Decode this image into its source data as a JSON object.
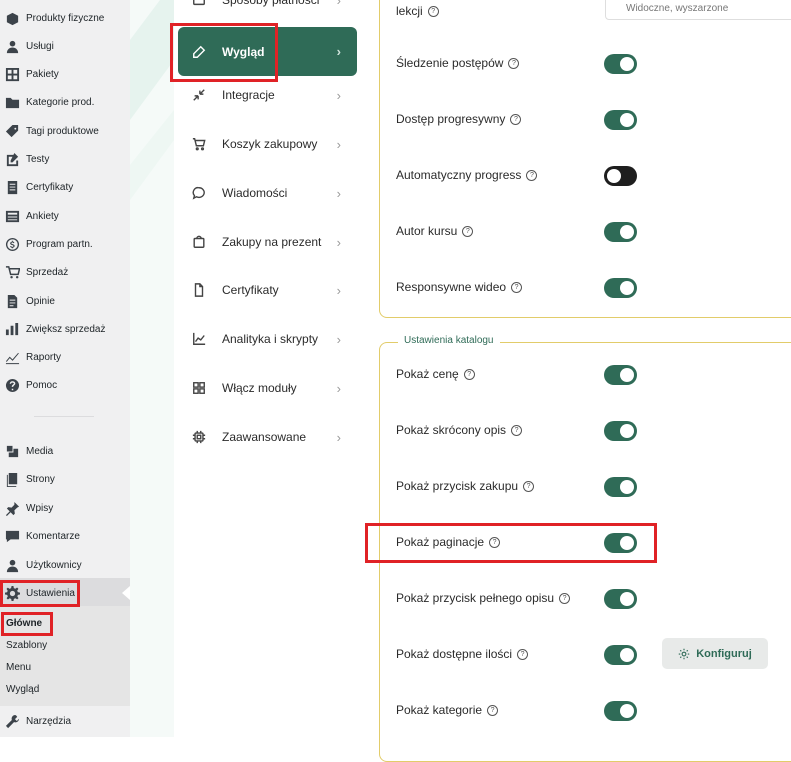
{
  "sidebar": {
    "items": [
      {
        "label": "Produkty fizyczne",
        "icon": "box-icon"
      },
      {
        "label": "Usługi",
        "icon": "user-icon"
      },
      {
        "label": "Pakiety",
        "icon": "grid-icon"
      },
      {
        "label": "Kategorie prod.",
        "icon": "folder-icon"
      },
      {
        "label": "Tagi produktowe",
        "icon": "tag-icon"
      },
      {
        "label": "Testy",
        "icon": "edit-icon"
      },
      {
        "label": "Certyfikaty",
        "icon": "document-icon"
      },
      {
        "label": "Ankiety",
        "icon": "form-icon"
      },
      {
        "label": "Program partn.",
        "icon": "dollar-icon"
      },
      {
        "label": "Sprzedaż",
        "icon": "cart-icon"
      },
      {
        "label": "Opinie",
        "icon": "page-icon"
      },
      {
        "label": "Zwiększ sprzedaż",
        "icon": "bar-chart-icon"
      },
      {
        "label": "Raporty",
        "icon": "line-chart-icon"
      },
      {
        "label": "Pomoc",
        "icon": "help-icon"
      },
      {
        "label": "Media",
        "icon": "media-icon"
      },
      {
        "label": "Strony",
        "icon": "pages-icon"
      },
      {
        "label": "Wpisy",
        "icon": "pin-icon"
      },
      {
        "label": "Komentarze",
        "icon": "comment-icon"
      },
      {
        "label": "Użytkownicy",
        "icon": "users-icon"
      },
      {
        "label": "Ustawienia",
        "icon": "gear-icon"
      },
      {
        "label": "Narzędzia",
        "icon": "wrench-icon"
      }
    ],
    "submenu": [
      "Główne",
      "Szablony",
      "Menu",
      "Wygląd"
    ]
  },
  "plugin_nav": {
    "items": [
      {
        "label": "Sposoby płatności",
        "icon": "payment-icon"
      },
      {
        "label": "Wygląd",
        "icon": "pencil-icon",
        "active": true
      },
      {
        "label": "Integracje",
        "icon": "integration-icon"
      },
      {
        "label": "Koszyk zakupowy",
        "icon": "cart-icon"
      },
      {
        "label": "Wiadomości",
        "icon": "message-icon"
      },
      {
        "label": "Zakupy na prezent",
        "icon": "gift-icon"
      },
      {
        "label": "Certyfikaty",
        "icon": "document-icon"
      },
      {
        "label": "Analityka i skrypty",
        "icon": "analytics-icon"
      },
      {
        "label": "Włącz moduły",
        "icon": "modules-icon"
      },
      {
        "label": "Zaawansowane",
        "icon": "chip-icon"
      }
    ]
  },
  "course_settings": {
    "partial_label": "lekcji",
    "select_value": "Widoczne, wyszarzone",
    "rows": [
      {
        "label": "Śledzenie postępów",
        "on": true
      },
      {
        "label": "Dostęp progresywny",
        "on": true
      },
      {
        "label": "Automatyczny progress",
        "on": false
      },
      {
        "label": "Autor kursu",
        "on": true
      },
      {
        "label": "Responsywne wideo",
        "on": true
      }
    ]
  },
  "catalog_settings": {
    "legend": "Ustawienia katalogu",
    "rows": [
      {
        "label": "Pokaż cenę",
        "on": true
      },
      {
        "label": "Pokaż skrócony opis",
        "on": true
      },
      {
        "label": "Pokaż przycisk zakupu",
        "on": true
      },
      {
        "label": "Pokaż paginacje",
        "on": true
      },
      {
        "label": "Pokaż przycisk pełnego opisu",
        "on": true
      },
      {
        "label": "Pokaż dostępne ilości",
        "on": true
      },
      {
        "label": "Pokaż kategorie",
        "on": true
      }
    ],
    "configure_button": "Konfiguruj"
  },
  "colors": {
    "accent": "#2f6b57",
    "highlight": "#e02226",
    "panel_border": "#e2cc6a"
  }
}
